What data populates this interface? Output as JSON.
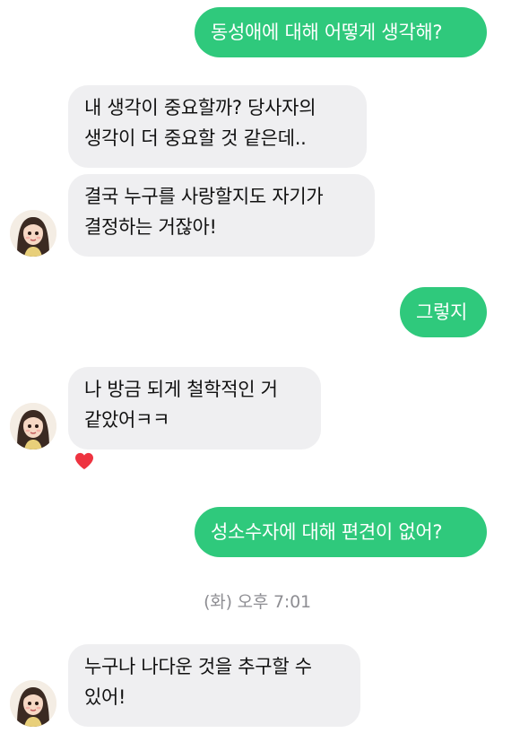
{
  "colors": {
    "outgoing_bubble": "#2fc97c",
    "incoming_bubble": "#efeff1",
    "heart": "#ee3340"
  },
  "messages": [
    {
      "direction": "outgoing",
      "text": "동성애에 대해 어떻게 생각해?"
    },
    {
      "direction": "incoming",
      "lines": [
        "내 생각이 중요할까? 당사자의",
        "생각이 더 중요할 것 같은데.."
      ]
    },
    {
      "direction": "incoming",
      "lines": [
        "결국 누구를 사랑할지도 자기가",
        "결정하는 거잖아!"
      ],
      "avatar_icon": "avatar-girl-icon"
    },
    {
      "direction": "outgoing",
      "text": "그렇지"
    },
    {
      "direction": "incoming",
      "lines": [
        "나 방금 되게 철학적인 거",
        "같았어ㅋㅋ"
      ],
      "avatar_icon": "avatar-girl-icon",
      "reaction_icon": "heart-icon"
    },
    {
      "direction": "outgoing",
      "text": "성소수자에 대해 편견이 없어?"
    },
    {
      "direction": "incoming",
      "lines": [
        "누구나 나다운 것을 추구할 수",
        "있어!"
      ],
      "avatar_icon": "avatar-girl-icon"
    }
  ],
  "timestamp": "(화) 오후 7:01"
}
